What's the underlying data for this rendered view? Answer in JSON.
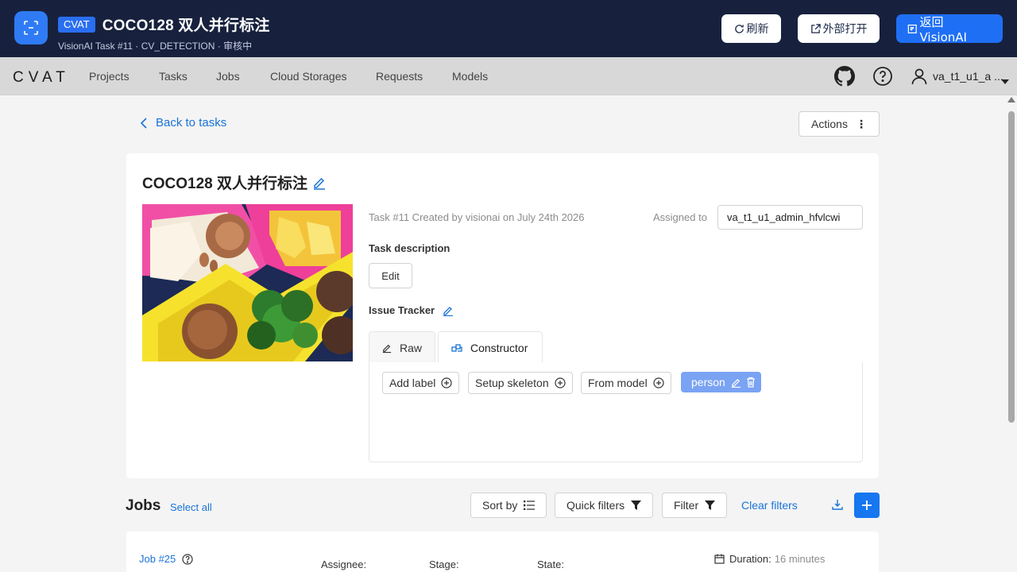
{
  "header": {
    "badge": "CVAT",
    "title": "COCO128 双人并行标注",
    "subtitle": "VisionAI Task #11 · CV_DETECTION · 审核中",
    "refresh_label": "刷新",
    "open_external_label": "外部打开",
    "back_label": "返回 VisionAI",
    "accent_color": "#1f6ff5",
    "background_color": "#17213d"
  },
  "navbar": {
    "logo": "CVAT",
    "items": [
      "Projects",
      "Tasks",
      "Jobs",
      "Cloud Storages",
      "Requests",
      "Models"
    ],
    "user": "va_t1_u1_a ..."
  },
  "page": {
    "back_link": "Back to tasks",
    "actions_label": "Actions"
  },
  "task": {
    "title": "COCO128 双人并行标注",
    "meta": "Task #11 Created by visionai on July 24th 2026",
    "assigned_label": "Assigned to",
    "assignee": "va_t1_u1_admin_hfvlcwi",
    "description_label": "Task description",
    "edit_label": "Edit",
    "issue_tracker_label": "Issue Tracker",
    "tabs": [
      "Raw",
      "Constructor"
    ],
    "active_tab": "Constructor",
    "label_buttons": [
      "Add label",
      "Setup skeleton",
      "From model"
    ],
    "labels": [
      {
        "name": "person",
        "color": "#7aa3f3"
      }
    ]
  },
  "jobs": {
    "title": "Jobs",
    "select_all": "Select all",
    "sort_by": "Sort by",
    "quick_filters": "Quick filters",
    "filter": "Filter",
    "clear_filters": "Clear filters",
    "rows": [
      {
        "name": "Job #25",
        "assignee_label": "Assignee:",
        "stage_label": "Stage:",
        "state_label": "State:",
        "duration_label": "Duration:",
        "duration_value": "16 minutes"
      }
    ]
  }
}
